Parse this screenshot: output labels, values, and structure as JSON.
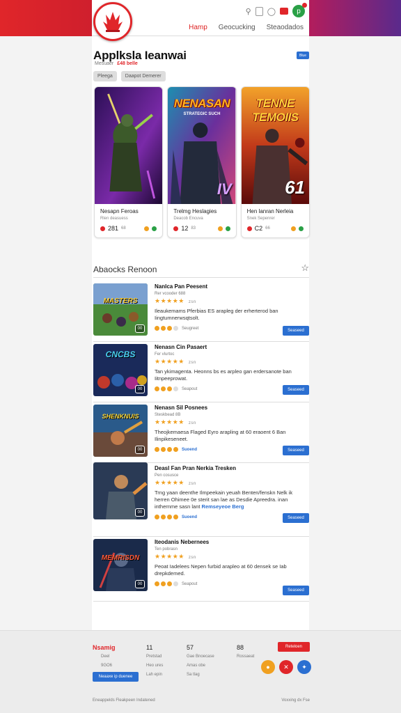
{
  "header": {
    "nav": [
      "Hamp",
      "Geocucking",
      "Steaodados"
    ]
  },
  "page": {
    "title": "Applksla Ieanwai",
    "subtitle": "Mesuaer",
    "subtitle_price": "£48 belle",
    "top_button": "Blue",
    "chips": [
      "Pleega",
      "Daapot Demerer"
    ]
  },
  "featured": [
    {
      "art_title": "NENASAN",
      "art_sub": "STRATEGIC SUCH",
      "art_num": "",
      "name": "Nesapn Feroas",
      "meta": "Rlen deasuess",
      "rating": "281",
      "rating_sub": "68"
    },
    {
      "art_title": "",
      "art_sub": "",
      "art_num": "",
      "name": "Trelmg Heslagies",
      "meta": "Deacob Encuva",
      "rating": "12",
      "rating_sub": "83"
    },
    {
      "art_title": "TENNE TEMOIIS",
      "art_sub": "",
      "art_num": "61",
      "name": "Hen lanran Nerleia",
      "meta": "Snek Sepenrer",
      "rating": "C2",
      "rating_sub": "66"
    }
  ],
  "section": {
    "title": "Abaocks Renoon"
  },
  "list": [
    {
      "thumb_label": "MASTERS",
      "name": "Nanlca Pan Peesent",
      "sub": "Rer vcooder 688",
      "rating_note": "zsn",
      "desc": "Ileaukemams Pferbias ES arapleg der erherterod ban Iingtumnerwsqtsolt.",
      "desc_hl": "",
      "meta": "Seugreet",
      "meta_blue": "",
      "button": "Seaseed"
    },
    {
      "thumb_label": "CNCBS",
      "name": "Nenasn Cin Pasaert",
      "sub": "Fer vlurtoc",
      "rating_note": "zsn",
      "desc": "Tan ykimagenta. Heonns bs es arpleo gan erdersanote ban Iitnpeeprowat.",
      "desc_hl": "",
      "meta": "Seapout",
      "meta_blue": "",
      "button": "Seaseed"
    },
    {
      "thumb_label": "SHENKNUIS",
      "name": "Nenasn Sil Posnees",
      "sub": "Steskbead 8B",
      "rating_note": "zsn",
      "desc": "Theojkemaesa Flaged Eyro arapling at 60 eraoent 6 Ban Ilinpikeseneet.",
      "desc_hl": "",
      "meta": "",
      "meta_blue": "Suoend",
      "button": "Seaseed"
    },
    {
      "thumb_label": "",
      "name": "Deasl Fan Pran Nerkia Tresken",
      "sub": "Pen cosusce",
      "rating_note": "zsn",
      "desc": "Trng yaan deenthe Ilmpeekain yeuah Benten/fenskn Nelk ik herren Ohimee 0e sterit san lae as Desdie Apreedra. inan inthernme sasn lant",
      "desc_hl": "Remseyeoe Berg",
      "meta": "",
      "meta_blue": "Suoend",
      "button": "Seaseed"
    },
    {
      "thumb_label": "MEMRISDN",
      "name": "Iteodanis Nebernees",
      "sub": "Ten pobrasn",
      "rating_note": "zsn",
      "desc": "Peoat Iadelees Nepen furbid arapleo at 60 densek se Iab drepkdemed.",
      "desc_hl": "",
      "meta": "Seapout",
      "meta_blue": "",
      "button": "Seaseed"
    }
  ],
  "footer": {
    "col1_title": "Nsamig",
    "col1_lines": [
      "Deel",
      "9GO6"
    ],
    "col1_button": "Neaaxe ip duenee",
    "col2_title": "11",
    "col2_lines": [
      "Pretstad",
      "Heo ures",
      "Lah epin"
    ],
    "col3_title": "57",
    "col3_lines": [
      "Gae Bnoecase",
      "Amas obe",
      "Sa tlag"
    ],
    "col4_title": "88",
    "col4_lines": [
      "Rossaeat"
    ],
    "red_button": "Reteloen",
    "bottom_left": "Eneappelds Fleakpeen Indatened",
    "bottom_right": "Voxxing dx Fse"
  },
  "colors": {
    "brand_red": "#e0262a",
    "accent_blue": "#2b6fd1",
    "star": "#f0a020"
  }
}
